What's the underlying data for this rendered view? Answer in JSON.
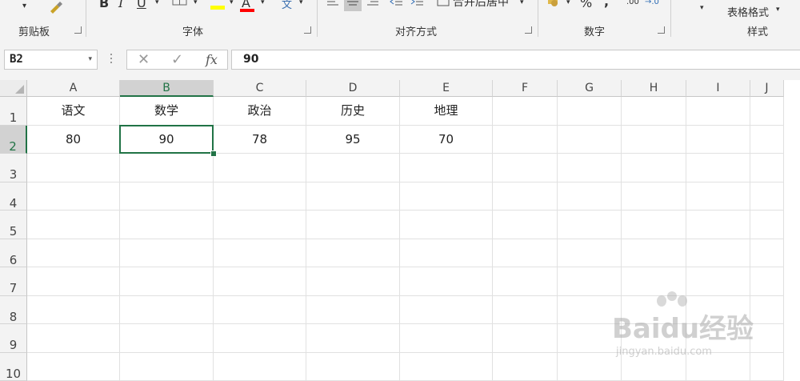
{
  "ribbon": {
    "clipboard_label": "剪贴板",
    "font_label": "字体",
    "alignment_label": "对齐方式",
    "number_label": "数字",
    "styles_label": "样式",
    "bold": "B",
    "italic": "I",
    "underline": "U",
    "font_color_glyph": "A",
    "phonetic_glyph": "文",
    "merge_center": "合并后居中",
    "percent": "%",
    "comma": ",",
    "increase_decimal": ".00",
    "decrease_decimal": "→.0",
    "table_format": "表格格式"
  },
  "formula_bar": {
    "name_box": "B2",
    "fx": "fx",
    "formula_value": "90"
  },
  "columns": [
    "A",
    "B",
    "C",
    "D",
    "E",
    "F",
    "G",
    "H",
    "I",
    "J"
  ],
  "rows": [
    "1",
    "2",
    "3",
    "4",
    "5",
    "6",
    "7",
    "8",
    "9",
    "10"
  ],
  "cells": {
    "A1": "语文",
    "B1": "数学",
    "C1": "政治",
    "D1": "历史",
    "E1": "地理",
    "A2": "80",
    "B2": "90",
    "C2": "78",
    "D2": "95",
    "E2": "70"
  },
  "selection": "B2",
  "colors": {
    "accent": "#217346",
    "ribbon_bg": "#f3f3f3",
    "grid_line": "#e1e1e1"
  },
  "watermark": {
    "brand": "Baidu经验",
    "url": "jingyan.baidu.com"
  }
}
